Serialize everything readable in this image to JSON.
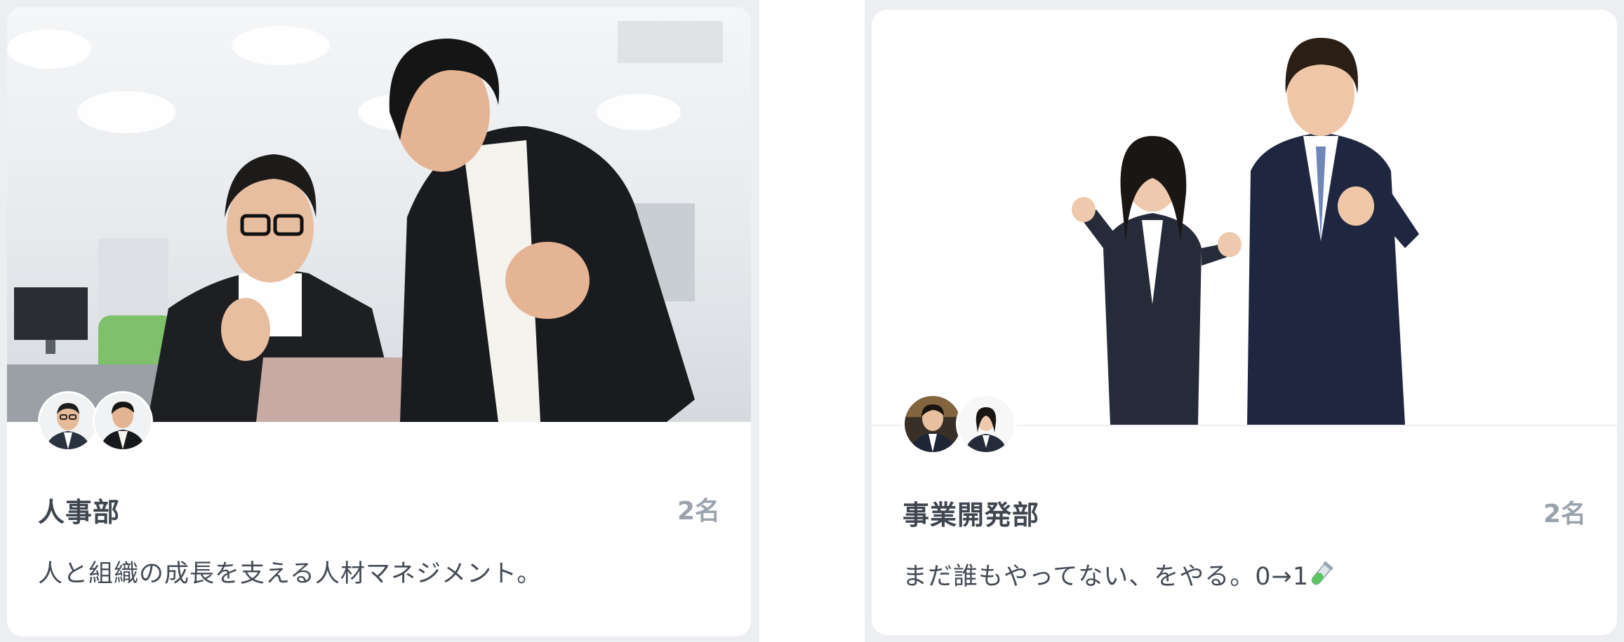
{
  "teams": [
    {
      "name": "人事部",
      "member_count": "2名",
      "description": "人と組織の成長を支える人材マネジメント。",
      "avatars": [
        "member-1",
        "member-2"
      ]
    },
    {
      "name": "事業開発部",
      "member_count": "2名",
      "description": "まだ誰もやってない、をやる。0→1",
      "description_emoji": "test-tube-icon",
      "avatars": [
        "member-1",
        "member-2"
      ]
    }
  ],
  "colors": {
    "title": "#3f4650",
    "count": "#9aa3ad",
    "description": "#444b55",
    "column_background": "#eceef1"
  }
}
